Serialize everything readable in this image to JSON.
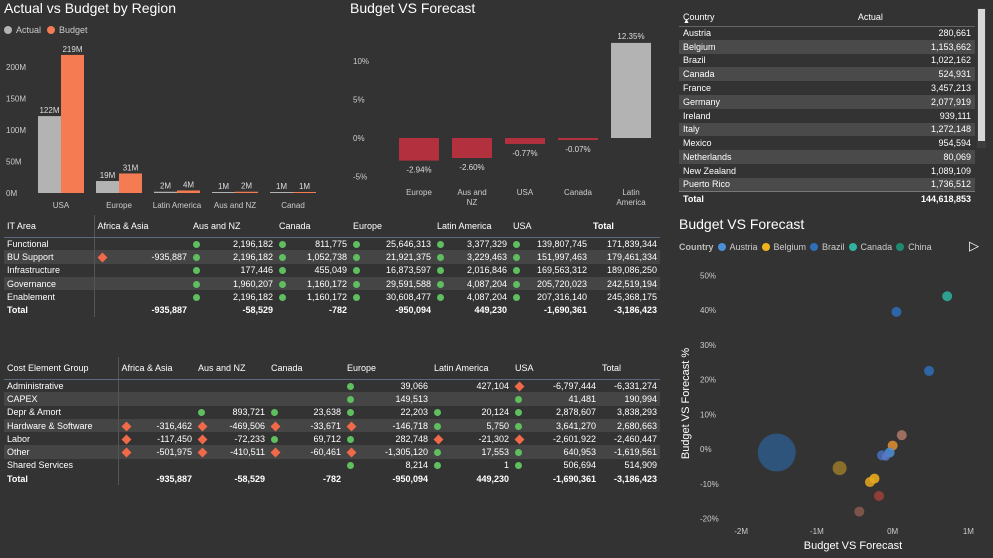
{
  "chart1": {
    "title": "Actual vs Budget by Region",
    "legend": [
      {
        "name": "Actual",
        "color": "#b3b3b3"
      },
      {
        "name": "Budget",
        "color": "#f47b52"
      }
    ],
    "y_ticks": [
      "200M",
      "150M",
      "100M",
      "50M",
      "0M"
    ]
  },
  "chart2": {
    "title": "Budget VS Forecast",
    "y_ticks": [
      "10%",
      "5%",
      "0%",
      "-5%"
    ]
  },
  "table_country": {
    "headers": [
      "Country",
      "Actual"
    ],
    "rows": [
      [
        "Austria",
        "280,661"
      ],
      [
        "Belgium",
        "1,153,662"
      ],
      [
        "Brazil",
        "1,022,162"
      ],
      [
        "Canada",
        "524,931"
      ],
      [
        "France",
        "3,457,213"
      ],
      [
        "Germany",
        "2,077,919"
      ],
      [
        "Ireland",
        "939,111"
      ],
      [
        "Italy",
        "1,272,148"
      ],
      [
        "Mexico",
        "954,594"
      ],
      [
        "Netherlands",
        "80,069"
      ],
      [
        "New Zealand",
        "1,089,109"
      ],
      [
        "Puerto Rico",
        "1,736,512"
      ]
    ],
    "total": [
      "Total",
      "144,618,853"
    ]
  },
  "matrix1": {
    "headers": [
      "IT Area",
      "Africa & Asia",
      "Aus and NZ",
      "Canada",
      "Europe",
      "Latin America",
      "USA",
      "Total"
    ],
    "rows": [
      {
        "label": "Functional",
        "v": [
          "",
          "2,196,182",
          "811,775",
          "25,646,313",
          "3,377,329",
          "139,807,745",
          "171,839,344"
        ],
        "m": [
          "",
          "g",
          "g",
          "g",
          "g",
          "g",
          ""
        ]
      },
      {
        "label": "BU Support",
        "v": [
          "-935,887",
          "2,196,182",
          "1,052,738",
          "21,921,375",
          "3,229,463",
          "151,997,463",
          "179,461,334"
        ],
        "m": [
          "r",
          "g",
          "g",
          "g",
          "g",
          "g",
          ""
        ]
      },
      {
        "label": "Infrastructure",
        "v": [
          "",
          "177,446",
          "455,049",
          "16,873,597",
          "2,016,846",
          "169,563,312",
          "189,086,250"
        ],
        "m": [
          "",
          "g",
          "g",
          "g",
          "g",
          "g",
          ""
        ]
      },
      {
        "label": "Governance",
        "v": [
          "",
          "1,960,207",
          "1,160,172",
          "29,591,588",
          "4,087,204",
          "205,720,023",
          "242,519,194"
        ],
        "m": [
          "",
          "g",
          "g",
          "g",
          "g",
          "g",
          ""
        ]
      },
      {
        "label": "Enablement",
        "v": [
          "",
          "2,196,182",
          "1,160,172",
          "30,608,477",
          "4,087,204",
          "207,316,140",
          "245,368,175"
        ],
        "m": [
          "",
          "g",
          "g",
          "g",
          "g",
          "g",
          ""
        ]
      }
    ],
    "total": {
      "label": "Total",
      "v": [
        "-935,887",
        "-58,529",
        "-782",
        "-950,094",
        "449,230",
        "-1,690,361",
        "-3,186,423"
      ]
    }
  },
  "matrix2": {
    "headers": [
      "Cost Element Group",
      "Africa & Asia",
      "Aus and NZ",
      "Canada",
      "Europe",
      "Latin America",
      "USA",
      "Total"
    ],
    "rows": [
      {
        "label": "Administrative",
        "v": [
          "",
          "",
          "",
          "39,066",
          "427,104",
          "-6,797,444",
          "-6,331,274"
        ],
        "m": [
          "",
          "",
          "",
          "g",
          "",
          "r",
          ""
        ]
      },
      {
        "label": "CAPEX",
        "v": [
          "",
          "",
          "",
          "149,513",
          "",
          "41,481",
          "190,994"
        ],
        "m": [
          "",
          "",
          "",
          "g",
          "",
          "g",
          ""
        ]
      },
      {
        "label": "Depr & Amort",
        "v": [
          "",
          "893,721",
          "23,638",
          "22,203",
          "20,124",
          "2,878,607",
          "3,838,293"
        ],
        "m": [
          "",
          "g",
          "g",
          "g",
          "g",
          "g",
          ""
        ]
      },
      {
        "label": "Hardware & Software",
        "v": [
          "-316,462",
          "-469,506",
          "-33,671",
          "-146,718",
          "5,750",
          "3,641,270",
          "2,680,663"
        ],
        "m": [
          "r",
          "r",
          "r",
          "r",
          "g",
          "g",
          ""
        ]
      },
      {
        "label": "Labor",
        "v": [
          "-117,450",
          "-72,233",
          "69,712",
          "282,748",
          "-21,302",
          "-2,601,922",
          "-2,460,447"
        ],
        "m": [
          "r",
          "r",
          "g",
          "g",
          "r",
          "r",
          ""
        ]
      },
      {
        "label": "Other",
        "v": [
          "-501,975",
          "-410,511",
          "-60,461",
          "-1,305,120",
          "17,553",
          "640,953",
          "-1,619,561"
        ],
        "m": [
          "r",
          "r",
          "r",
          "r",
          "g",
          "g",
          ""
        ]
      },
      {
        "label": "Shared Services",
        "v": [
          "",
          "",
          "",
          "8,214",
          "1",
          "506,694",
          "514,909"
        ],
        "m": [
          "",
          "",
          "",
          "g",
          "g",
          "g",
          ""
        ]
      }
    ],
    "total": {
      "label": "Total",
      "v": [
        "-935,887",
        "-58,529",
        "-782",
        "-950,094",
        "449,230",
        "-1,690,361",
        "-3,186,423"
      ]
    }
  },
  "scatter": {
    "title": "Budget VS Forecast",
    "legend_label": "Country",
    "legend": [
      {
        "name": "Austria",
        "color": "#4a90d9"
      },
      {
        "name": "Belgium",
        "color": "#f2b21b"
      },
      {
        "name": "Brazil",
        "color": "#2e6fba"
      },
      {
        "name": "Canada",
        "color": "#2fb3a0"
      },
      {
        "name": "China",
        "color": "#1f8a70"
      }
    ],
    "x_label": "Budget VS Forecast",
    "y_label": "Budget VS Forecast %",
    "x_ticks": [
      "-2M",
      "-1M",
      "0M",
      "1M"
    ],
    "y_ticks": [
      "50%",
      "40%",
      "30%",
      "20%",
      "10%",
      "0%",
      "-10%",
      "-20%"
    ],
    "next_icon": "▷"
  },
  "chart_data": [
    {
      "type": "bar",
      "title": "Actual vs Budget by Region",
      "categories": [
        "USA",
        "Europe",
        "Latin America",
        "Aus and NZ",
        "Canad"
      ],
      "series": [
        {
          "name": "Actual",
          "values": [
            122,
            19,
            2,
            1,
            1
          ],
          "labels": [
            "122M",
            "19M",
            "2M",
            "1M",
            "1M"
          ]
        },
        {
          "name": "Budget",
          "values": [
            219,
            31,
            4,
            2,
            1
          ],
          "labels": [
            "219M",
            "31M",
            "4M",
            "2M",
            "1M"
          ]
        }
      ],
      "ylim": [
        0,
        230
      ],
      "legend": "top-left",
      "grid": false
    },
    {
      "type": "bar",
      "title": "Budget VS Forecast",
      "categories": [
        "Europe",
        "Aus and NZ",
        "USA",
        "Canada",
        "Latin America"
      ],
      "values": [
        -2.94,
        -2.6,
        -0.77,
        -0.07,
        12.35
      ],
      "labels": [
        "-2.94%",
        "-2.60%",
        "-0.77%",
        "-0.07%",
        "12.35%"
      ],
      "ylim": [
        -6,
        13
      ],
      "grid": false
    },
    {
      "type": "scatter",
      "title": "Budget VS Forecast",
      "xlabel": "Budget VS Forecast",
      "ylabel": "Budget VS Forecast %",
      "xlim": [
        -2.2,
        1.1
      ],
      "ylim": [
        -21,
        53
      ],
      "points": [
        {
          "x": -1.53,
          "y": -1,
          "r": 19,
          "color": "#2e5a8a"
        },
        {
          "x": -0.7,
          "y": -5.5,
          "r": 7,
          "color": "#9a7a2a"
        },
        {
          "x": 0.72,
          "y": 44,
          "r": 5,
          "color": "#2fb3a0"
        },
        {
          "x": 0.05,
          "y": 39.5,
          "r": 5,
          "color": "#2e6fba"
        },
        {
          "x": 0.48,
          "y": 22.5,
          "r": 5,
          "color": "#2e6fba"
        },
        {
          "x": 0.12,
          "y": 4,
          "r": 5,
          "color": "#b07a68"
        },
        {
          "x": 0.0,
          "y": 1,
          "r": 5,
          "color": "#e09030"
        },
        {
          "x": -0.04,
          "y": -1,
          "r": 5,
          "color": "#4a90d9"
        },
        {
          "x": -0.14,
          "y": -1.8,
          "r": 5,
          "color": "#4a70c0"
        },
        {
          "x": -0.09,
          "y": -2.2,
          "r": 4,
          "color": "#5a7ac8"
        },
        {
          "x": -0.24,
          "y": -8.5,
          "r": 5,
          "color": "#f2b21b"
        },
        {
          "x": -0.3,
          "y": -9.5,
          "r": 5,
          "color": "#e8a820"
        },
        {
          "x": -0.18,
          "y": -13.5,
          "r": 5,
          "color": "#a04038"
        },
        {
          "x": -0.44,
          "y": -18,
          "r": 5,
          "color": "#8a5a50"
        }
      ],
      "legend": "top-left",
      "grid": false
    }
  ]
}
